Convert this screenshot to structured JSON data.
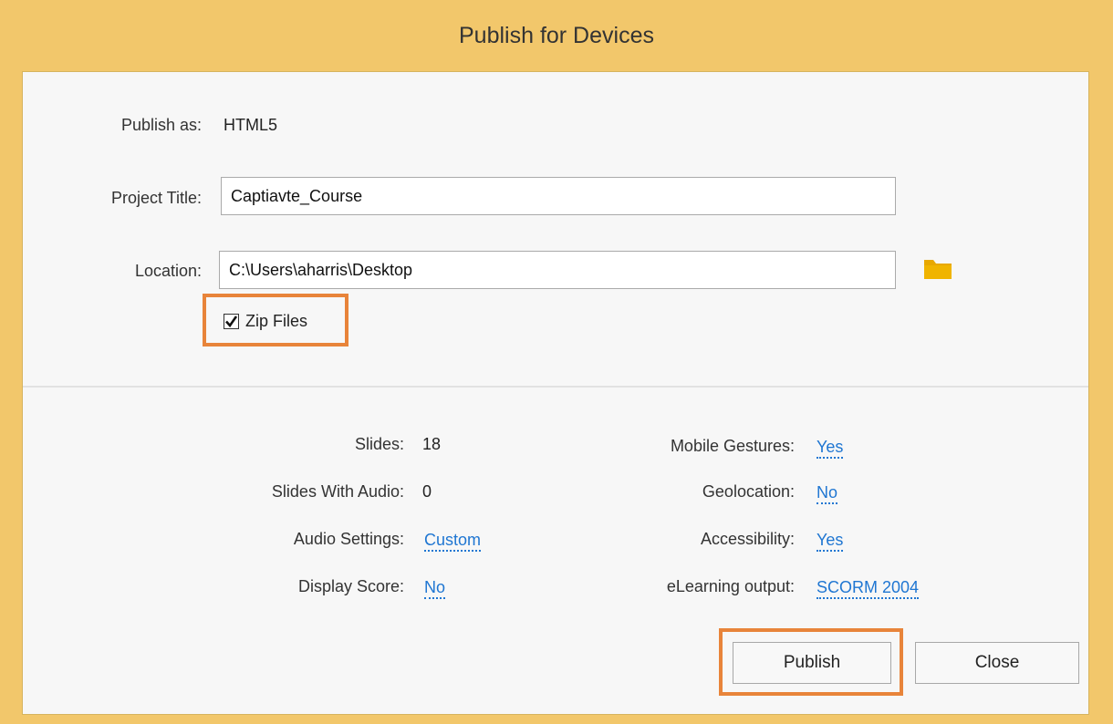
{
  "window": {
    "title": "Publish for Devices"
  },
  "publish_as": {
    "label": "Publish as:",
    "value": "HTML5"
  },
  "project_title": {
    "label": "Project Title:",
    "value": "Captiavte_Course"
  },
  "location": {
    "label": "Location:",
    "value": "C:\\Users\\aharris\\Desktop",
    "browse_icon": "folder-icon"
  },
  "zip_files": {
    "label": "Zip Files",
    "checked": true
  },
  "summary": {
    "slides": {
      "label": "Slides:",
      "value": "18"
    },
    "slides_with_audio": {
      "label": "Slides With Audio:",
      "value": "0"
    },
    "audio_settings": {
      "label": "Audio Settings:",
      "value": "Custom"
    },
    "display_score": {
      "label": "Display Score:",
      "value": "No"
    },
    "mobile_gestures": {
      "label": "Mobile Gestures:",
      "value": "Yes"
    },
    "geolocation": {
      "label": "Geolocation:",
      "value": "No"
    },
    "accessibility": {
      "label": "Accessibility:",
      "value": "Yes"
    },
    "elearning_output": {
      "label": "eLearning output:",
      "value": "SCORM 2004"
    }
  },
  "buttons": {
    "publish": "Publish",
    "close": "Close"
  },
  "colors": {
    "frame": "#f2c76b",
    "panel": "#f7f7f7",
    "link": "#1f76d2",
    "highlight": "#e8843a",
    "folder": "#e8a800"
  }
}
